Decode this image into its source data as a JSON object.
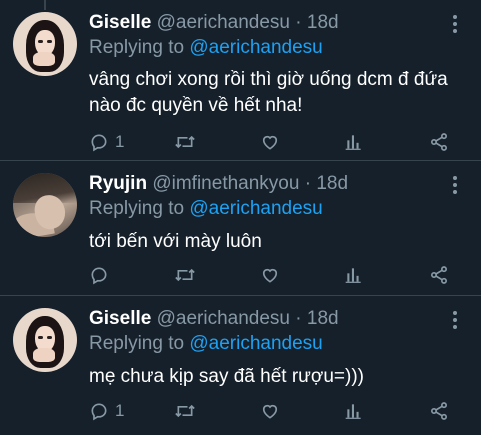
{
  "tweets": [
    {
      "author": "Giselle",
      "handle": "@aerichandesu",
      "separator": "·",
      "time": "18d",
      "replying_label": "Replying to",
      "replying_to": "@aerichandesu",
      "text": "vâng chơi xong rồi thì giờ uống dcm đ đứa nào đc quyền về hết nha!",
      "reply_count": "1",
      "avatar": "avatar-photo-giselle"
    },
    {
      "author": "Ryujin",
      "handle": "@imfinethankyou",
      "separator": "·",
      "time": "18d",
      "replying_label": "Replying to",
      "replying_to": "@aerichandesu",
      "text": "tới bến với mày luôn",
      "reply_count": "",
      "avatar": "avatar-photo-ryujin"
    },
    {
      "author": "Giselle",
      "handle": "@aerichandesu",
      "separator": "·",
      "time": "18d",
      "replying_label": "Replying to",
      "replying_to": "@aerichandesu",
      "text": "mẹ chưa kịp say đã hết rượu=)))",
      "reply_count": "1",
      "avatar": "avatar-photo-giselle"
    }
  ],
  "icons": {
    "reply": "reply-icon",
    "retweet": "retweet-icon",
    "like": "heart-icon",
    "stats": "analytics-icon",
    "share": "share-icon",
    "more": "more-vertical-icon"
  },
  "colors": {
    "background": "#15202b",
    "divider": "#38444d",
    "secondary_text": "#8899a6",
    "link": "#1da1f2",
    "primary_text": "#ffffff"
  }
}
